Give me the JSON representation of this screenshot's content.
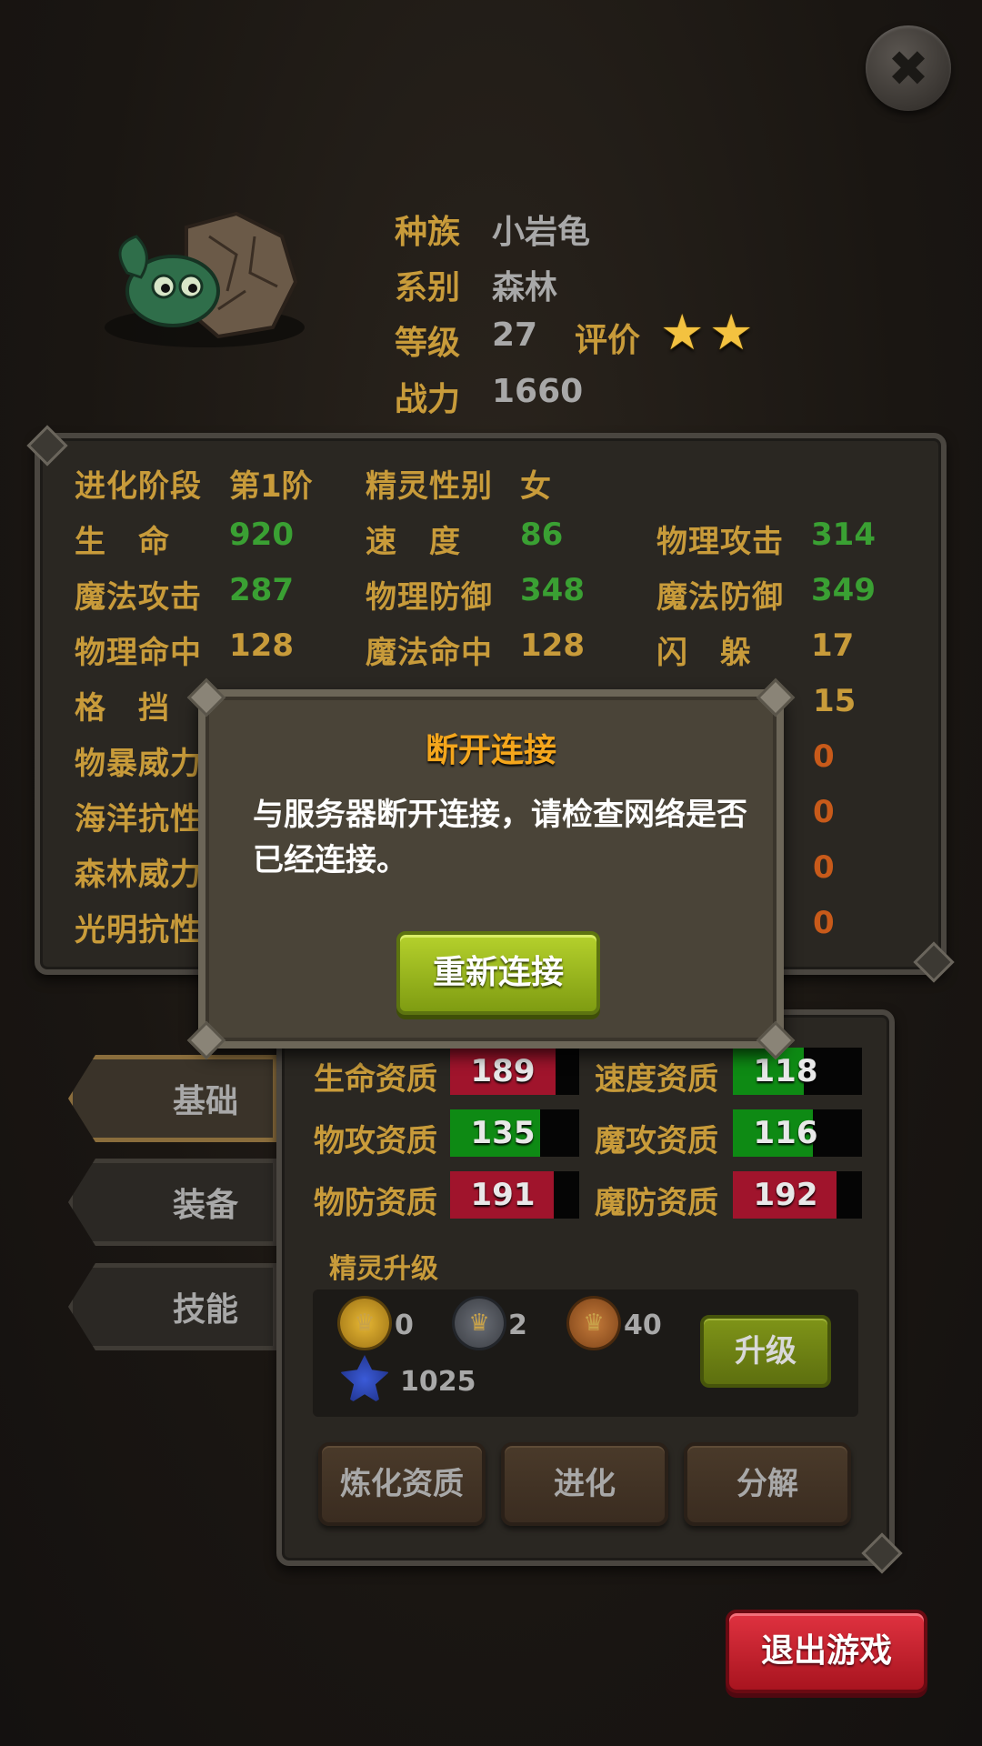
{
  "close_icon": "close-icon",
  "pet_info": {
    "race_label": "种族",
    "race_value": "小岩龟",
    "element_label": "系别",
    "element_value": "森林",
    "level_label": "等级",
    "level_value": "27",
    "rating_label": "评价",
    "rating_stars": 2,
    "power_label": "战力",
    "power_value": "1660"
  },
  "stats": {
    "evolution_label": "进化阶段",
    "evolution_value": "第1阶",
    "gender_label": "精灵性别",
    "gender_value": "女",
    "rows": [
      [
        {
          "label": "生　命",
          "value": "920"
        },
        {
          "label": "速　度",
          "value": "86"
        },
        {
          "label": "物理攻击",
          "value": "314"
        }
      ],
      [
        {
          "label": "魔法攻击",
          "value": "287"
        },
        {
          "label": "物理防御",
          "value": "348"
        },
        {
          "label": "魔法防御",
          "value": "349"
        }
      ],
      [
        {
          "label": "物理命中",
          "value": "128"
        },
        {
          "label": "魔法命中",
          "value": "128"
        },
        {
          "label": "闪　躲",
          "value": "17"
        }
      ]
    ],
    "partial_rows": [
      {
        "label": "格　挡",
        "value": "15"
      },
      {
        "label": "物暴威力",
        "value": "0"
      },
      {
        "label": "海洋抗性",
        "value": "0"
      },
      {
        "label": "森林威力",
        "value": "0"
      },
      {
        "label": "光明抗性",
        "value": "0"
      }
    ]
  },
  "dialog": {
    "title": "断开连接",
    "message": "与服务器断开连接，请检查网络是否已经连接。",
    "button": "重新连接"
  },
  "tabs": [
    "基础",
    "装备",
    "技能"
  ],
  "aptitudes": [
    {
      "label": "生命资质",
      "value": "189",
      "color": "#a0142c",
      "fill": 0.82
    },
    {
      "label": "速度资质",
      "value": "118",
      "color": "#0e8a14",
      "fill": 0.55
    },
    {
      "label": "物攻资质",
      "value": "135",
      "color": "#0e8a14",
      "fill": 0.7
    },
    {
      "label": "魔攻资质",
      "value": "116",
      "color": "#0e8a14",
      "fill": 0.62
    },
    {
      "label": "物防资质",
      "value": "191",
      "color": "#a0142c",
      "fill": 0.8
    },
    {
      "label": "魔防资质",
      "value": "192",
      "color": "#a0142c",
      "fill": 0.8
    }
  ],
  "upgrade": {
    "title": "精灵升级",
    "costs": [
      {
        "icon": "gold-crown-coin-icon",
        "value": "0"
      },
      {
        "icon": "silver-crown-coin-icon",
        "value": "2"
      },
      {
        "icon": "bronze-crown-coin-icon",
        "value": "40"
      },
      {
        "icon": "blue-crystal-icon",
        "value": "1025"
      }
    ],
    "button": "升级"
  },
  "actions": [
    "炼化资质",
    "进化",
    "分解"
  ],
  "exit_button": "退出游戏"
}
